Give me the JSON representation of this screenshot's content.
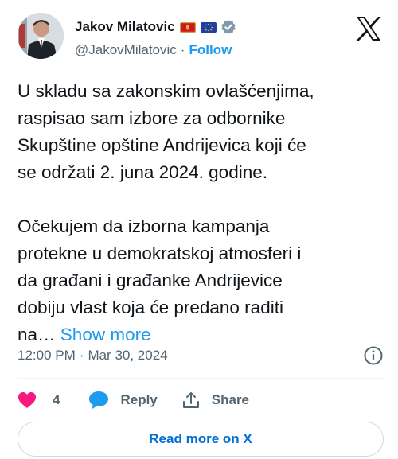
{
  "author": {
    "display_name": "Jakov Milatovic",
    "handle": "@JakovMilatovic",
    "separator": "·",
    "follow_label": "Follow",
    "flags": [
      "montenegro-flag-icon",
      "eu-flag-icon"
    ],
    "verified_icon": "verified-badge-icon"
  },
  "brand_icon": "x-logo-icon",
  "tweet": {
    "paragraph1": [
      "U skladu sa zakonskim ovlašćenjima,",
      "raspisao sam izbore za odbornike",
      "Skupštine opštine Andrijevica koji će",
      "se održati 2. juna 2024. godine."
    ],
    "paragraph2": [
      "Očekujem da izborna kampanja",
      "protekne u demokratskoj atmosferi i",
      "da građani i građanke Andrijevice",
      "dobiju vlast koja će predano raditi"
    ],
    "truncated_line": "na…",
    "show_more_label": "Show more"
  },
  "meta": {
    "time": "12:00 PM",
    "separator": "·",
    "date": "Mar 30, 2024",
    "info_icon": "info-icon"
  },
  "actions": {
    "like_count": "4",
    "reply_label": "Reply",
    "share_label": "Share"
  },
  "read_more_label": "Read more on X",
  "colors": {
    "accent": "#1d9bf0",
    "like": "#f91880",
    "text": "#0f1419",
    "muted": "#536471",
    "link_button": "#006fd6"
  }
}
